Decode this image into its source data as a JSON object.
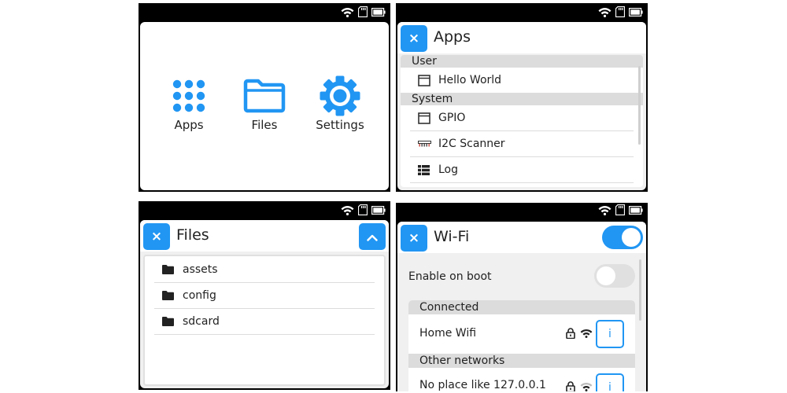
{
  "home": {
    "items": [
      {
        "label": "Apps",
        "icon": "apps-grid-icon"
      },
      {
        "label": "Files",
        "icon": "folder-icon"
      },
      {
        "label": "Settings",
        "icon": "gear-icon"
      }
    ]
  },
  "apps": {
    "close_label": "×",
    "title": "Apps",
    "sections": [
      {
        "title": "User",
        "items": [
          {
            "label": "Hello World",
            "icon": "window-icon"
          }
        ]
      },
      {
        "title": "System",
        "items": [
          {
            "label": "GPIO",
            "icon": "window-icon"
          },
          {
            "label": "I2C Scanner",
            "icon": "i2c-bus-icon"
          },
          {
            "label": "Log",
            "icon": "list-icon"
          }
        ]
      }
    ]
  },
  "files": {
    "close_label": "×",
    "title": "Files",
    "items": [
      {
        "label": "assets",
        "icon": "folder-icon"
      },
      {
        "label": "config",
        "icon": "folder-icon"
      },
      {
        "label": "sdcard",
        "icon": "folder-icon"
      }
    ]
  },
  "wifi": {
    "close_label": "×",
    "title": "Wi-Fi",
    "wifi_enabled": true,
    "enable_on_boot_label": "Enable on boot",
    "enable_on_boot": false,
    "connected_section": "Connected",
    "connected_network": "Home Wifi",
    "other_section": "Other networks",
    "other_network": "No place like 127.0.0.1",
    "info_label": "i"
  },
  "colors": {
    "accent": "#2196f3",
    "section_bg": "#dcdcdc",
    "toggle_off": "#e0e0e0",
    "statusbar_bg": "#000000"
  }
}
